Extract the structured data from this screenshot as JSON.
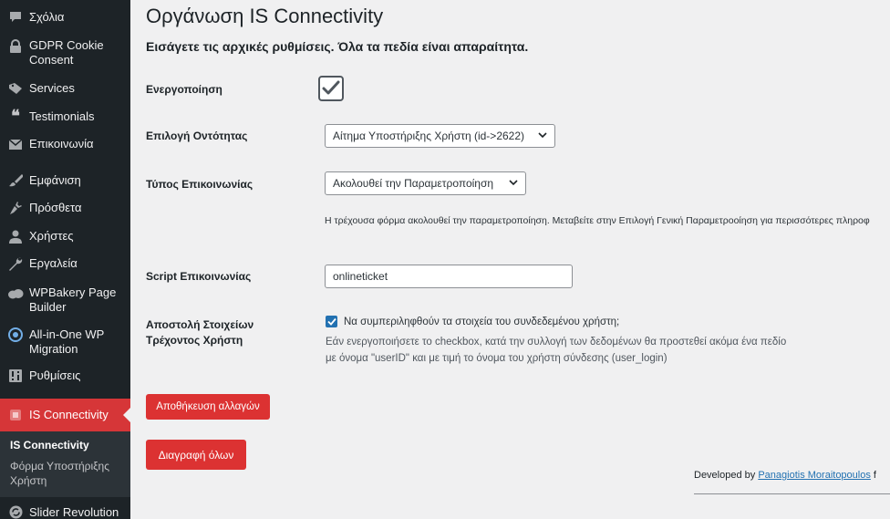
{
  "sidebar": {
    "items": [
      {
        "label": "Σχόλια",
        "icon": "comments-icon"
      },
      {
        "label": "GDPR Cookie Consent",
        "icon": "lock-icon"
      },
      {
        "label": "Services",
        "icon": "tag-icon"
      },
      {
        "label": "Testimonials",
        "icon": "quote-icon"
      },
      {
        "label": "Επικοινωνία",
        "icon": "envelope-icon"
      },
      {
        "label": "Εμφάνιση",
        "icon": "paintbrush-icon"
      },
      {
        "label": "Πρόσθετα",
        "icon": "plugin-icon"
      },
      {
        "label": "Χρήστες",
        "icon": "user-icon"
      },
      {
        "label": "Εργαλεία",
        "icon": "wrench-icon"
      },
      {
        "label": "WPBakery Page Builder",
        "icon": "cloud-icon"
      },
      {
        "label": "All-in-One WP Migration",
        "icon": "migration-icon"
      },
      {
        "label": "Ρυθμίσεις",
        "icon": "settings-icon"
      },
      {
        "label": "IS Connectivity",
        "icon": "is-icon"
      }
    ],
    "submenu": [
      {
        "label": "IS Connectivity"
      },
      {
        "label": "Φόρμα Υποστήριξης Χρήστη"
      }
    ],
    "slider_revolution": {
      "label": "Slider Revolution",
      "icon": "refresh-icon"
    },
    "active_color": "#d63638"
  },
  "main": {
    "title": "Οργάνωση IS Connectivity",
    "intro": "Εισάγετε τις αρχικές ρυθμίσεις. Όλα τα πεδία είναι απαραίτητα.",
    "fields": {
      "activation": {
        "label": "Ενεργοποίηση",
        "checked": true
      },
      "entity": {
        "label": "Επιλογή Οντότητας",
        "value": "Αίτημα Υποστήριξης Χρήστη (id->2622)"
      },
      "comm_type": {
        "label": "Τύπος Επικοινωνίας",
        "value": "Ακολουθεί την Παραμετροποίηση",
        "help": "Η τρέχουσα φόρμα ακολουθεί την παραμετροποίηση. Μεταβείτε στην Επιλογή Γενική Παραμετροοίηση για περισσότερες πληροφ"
      },
      "script": {
        "label": "Script Επικοινωνίας",
        "value": "onlineticket"
      },
      "send_user": {
        "label_line1": "Αποστολή Στοιχείων",
        "label_line2": "Τρέχοντος Χρήστη",
        "checkbox_label": "Να συμπεριληφθούν τα στοιχεία του συνδεδεμένου χρήστη;",
        "desc_line1": "Εάν ενεργοποιήσετε το checkbox, κατά την συλλογή των δεδομένων θα προστεθεί ακόμα ένα πεδίο",
        "desc_line2": "με όνομα \"userID\" και με τιμή το όνομα του χρήστη σύνδεσης (user_login)",
        "checked": true
      }
    },
    "buttons": {
      "save": "Αποθήκευση αλλαγών",
      "delete": "Διαγραφή όλων"
    },
    "footer": {
      "prefix": "Developed by ",
      "author": "Panagiotis Moraitopoulos",
      "suffix": " f"
    },
    "button_color": "#dc3232"
  }
}
